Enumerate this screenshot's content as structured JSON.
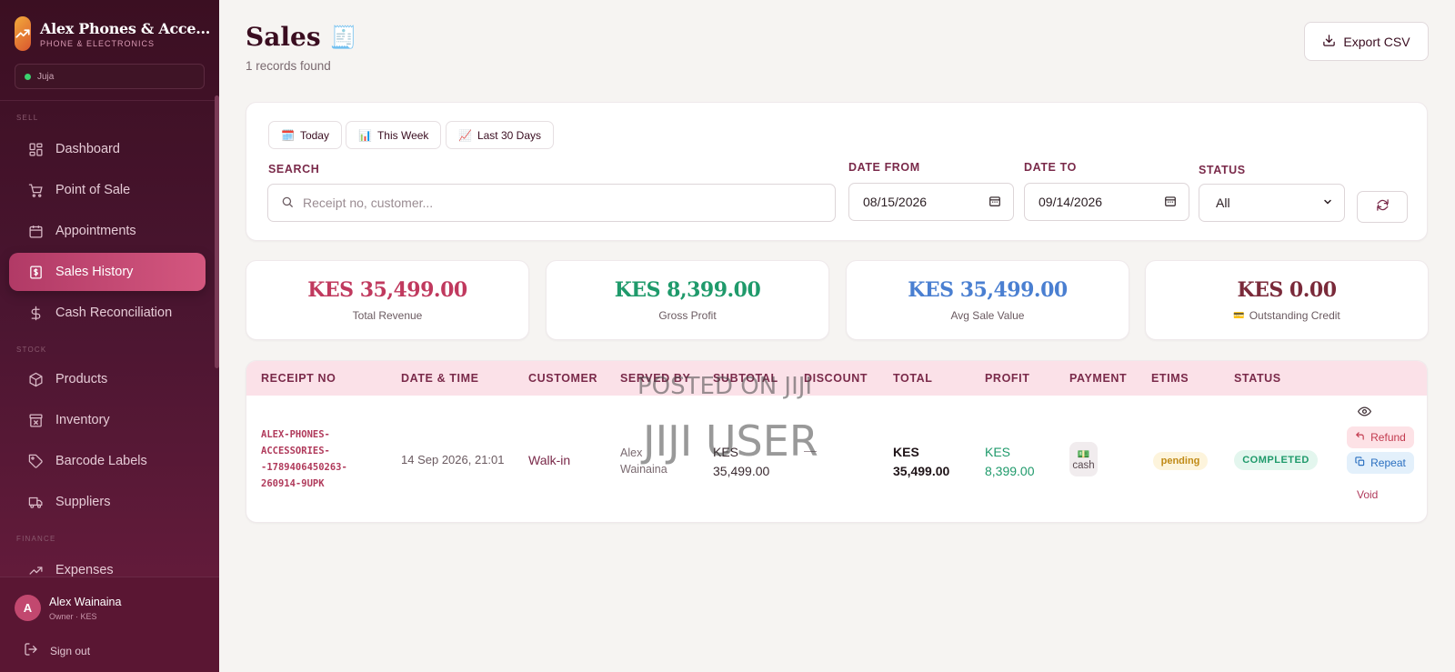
{
  "brand": {
    "name": "Alex Phones & Acce...",
    "subtitle": "PHONE & ELECTRONICS"
  },
  "branch": {
    "name": "Juja"
  },
  "sidebar": {
    "sections": {
      "sell": "SELL",
      "stock": "STOCK",
      "finance": "FINANCE"
    },
    "items": [
      {
        "label": "Dashboard",
        "icon": "grid-icon"
      },
      {
        "label": "Point of Sale",
        "icon": "cart-icon"
      },
      {
        "label": "Appointments",
        "icon": "calendar-icon"
      },
      {
        "label": "Sales History",
        "icon": "receipt-dollar-icon",
        "active": true
      },
      {
        "label": "Cash Reconciliation",
        "icon": "dollar-icon"
      },
      {
        "label": "Products",
        "icon": "box-icon"
      },
      {
        "label": "Inventory",
        "icon": "archive-icon"
      },
      {
        "label": "Barcode Labels",
        "icon": "tag-icon"
      },
      {
        "label": "Suppliers",
        "icon": "truck-icon"
      },
      {
        "label": "Expenses",
        "icon": "trend-icon"
      }
    ]
  },
  "user": {
    "initial": "A",
    "name": "Alex Wainaina",
    "role": "Owner · KES",
    "signout": "Sign out"
  },
  "header": {
    "title": "Sales",
    "records": "1 records found",
    "export_label": "Export CSV"
  },
  "filters": {
    "quick": [
      {
        "label": "Today",
        "icon": "🗓️"
      },
      {
        "label": "This Week",
        "icon": "📊"
      },
      {
        "label": "Last 30 Days",
        "icon": "📈"
      }
    ],
    "search_label": "SEARCH",
    "search_placeholder": "Receipt no, customer...",
    "date_from_label": "DATE FROM",
    "date_from": "08/15/2026",
    "date_to_label": "DATE TO",
    "date_to": "09/14/2026",
    "status_label": "STATUS",
    "status_value": "All"
  },
  "stats": [
    {
      "value": "KES 35,499.00",
      "label": "Total Revenue",
      "color": "#c0395e"
    },
    {
      "value": "KES 8,399.00",
      "label": "Gross Profit",
      "color": "#1f9a6b"
    },
    {
      "value": "KES 35,499.00",
      "label": "Avg Sale Value",
      "color": "#4a7fd1"
    },
    {
      "value": "KES 0.00",
      "label": "Outstanding Credit",
      "color": "#7a2a3a",
      "icon": "💳"
    }
  ],
  "table": {
    "columns": [
      "RECEIPT NO",
      "DATE & TIME",
      "CUSTOMER",
      "SERVED BY",
      "SUBTOTAL",
      "DISCOUNT",
      "TOTAL",
      "PROFIT",
      "PAYMENT",
      "ETIMS",
      "STATUS"
    ],
    "row": {
      "receipt_lines": [
        "ALEX-PHONES-",
        "ACCESSORIES-",
        "-1789406450263-",
        "260914-9UPK"
      ],
      "datetime": "14 Sep 2026, 21:01",
      "customer": "Walk-in",
      "served_by_lines": [
        "Alex",
        "Wainaina"
      ],
      "subtotal_lines": [
        "KES",
        "35,499.00"
      ],
      "discount": "—",
      "total_lines": [
        "KES",
        "35,499.00"
      ],
      "profit_lines": [
        "KES",
        "8,399.00"
      ],
      "payment_icon": "💵",
      "payment": "cash",
      "etims": "pending",
      "status": "COMPLETED",
      "actions": {
        "refund": "Refund",
        "repeat": "Repeat",
        "void": "Void"
      }
    }
  },
  "watermark": {
    "line1": "POSTED ON JIJI",
    "line2": "JIJI USER"
  }
}
